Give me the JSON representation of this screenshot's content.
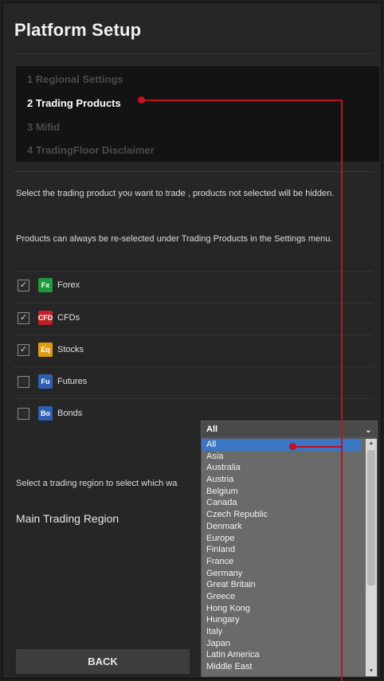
{
  "header": {
    "title": "Platform Setup"
  },
  "steps": [
    {
      "label": "1 Regional Settings",
      "active": false
    },
    {
      "label": "2 Trading Products",
      "active": true
    },
    {
      "label": "3 Mifid",
      "active": false
    },
    {
      "label": "4 TradingFloor Disclaimer",
      "active": false
    }
  ],
  "info": {
    "line1": "Select the trading product you want to trade , products not selected will be hidden.",
    "line2": "Products can always be re-selected under Trading Products in the Settings menu."
  },
  "products": [
    {
      "badge": "Fx",
      "label": "Forex",
      "checked": true,
      "color": "#1f9a3a",
      "icon": "forex-icon"
    },
    {
      "badge": "CFD",
      "label": "CFDs",
      "checked": true,
      "color": "#c0202a",
      "icon": "cfd-icon"
    },
    {
      "badge": "Eq",
      "label": "Stocks",
      "checked": true,
      "color": "#e09a10",
      "icon": "stocks-icon"
    },
    {
      "badge": "Fu",
      "label": "Futures",
      "checked": false,
      "color": "#2f5fb0",
      "icon": "futures-icon"
    },
    {
      "badge": "Bo",
      "label": "Bonds",
      "checked": false,
      "color": "#2f5fb0",
      "icon": "bonds-icon"
    }
  ],
  "region": {
    "info_text": "Select a trading region to select which wa",
    "main_label": "Main Trading Region",
    "selected": "All",
    "options": [
      "All",
      "Asia",
      "Australia",
      "Austria",
      "Belgium",
      "Canada",
      "Czech Republic",
      "Denmark",
      "Europe",
      "Finland",
      "France",
      "Germany",
      "Great Britain",
      "Greece",
      "Hong Kong",
      "Hungary",
      "Italy",
      "Japan",
      "Latin America",
      "Middle East"
    ]
  },
  "footer": {
    "back_label": "BACK"
  },
  "colors": {
    "accent": "#3a76c4",
    "callout": "#c4101f"
  },
  "check_glyph": "✓",
  "chevron_glyph": "⌄",
  "scroll_up_glyph": "▲",
  "scroll_down_glyph": "▼"
}
